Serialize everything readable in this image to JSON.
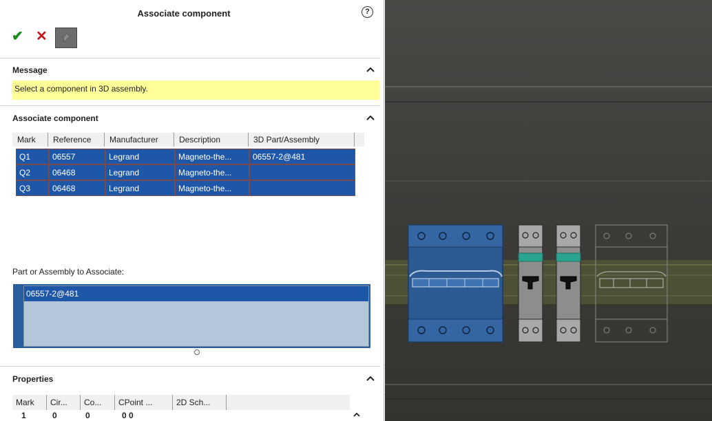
{
  "panel": {
    "title": "Associate component",
    "help_glyph": "?",
    "ok_glyph": "✔",
    "cancel_glyph": "✕",
    "pin_icon": "pushpin-icon"
  },
  "message": {
    "title": "Message",
    "text": "Select a component in 3D assembly."
  },
  "associate": {
    "title": "Associate component",
    "columns": [
      "Mark",
      "Reference",
      "Manufacturer",
      "Description",
      "3D Part/Assembly"
    ],
    "rows": [
      {
        "mark": "Q1",
        "reference": "06557",
        "manufacturer": "Legrand",
        "description": "Magneto-the...",
        "part": "06557-2@481"
      },
      {
        "mark": "Q2",
        "reference": "06468",
        "manufacturer": "Legrand",
        "description": "Magneto-the...",
        "part": ""
      },
      {
        "mark": "Q3",
        "reference": "06468",
        "manufacturer": "Legrand",
        "description": "Magneto-the...",
        "part": ""
      }
    ],
    "part_label": "Part or Assembly to Associate:",
    "part_items": [
      "06557-2@481"
    ]
  },
  "properties": {
    "title": "Properties",
    "columns": [
      "Mark",
      "Cir...",
      "Co...",
      "CPoint ...",
      "2D Sch..."
    ],
    "values": [
      "1",
      "0",
      "0",
      "0 0"
    ]
  },
  "colors": {
    "selection": "#1f57a8",
    "message_bg": "#ffff99",
    "viewport_bg": "#3d3c39",
    "highlight_component": "#2c5a92",
    "rail": "#5f6440"
  }
}
